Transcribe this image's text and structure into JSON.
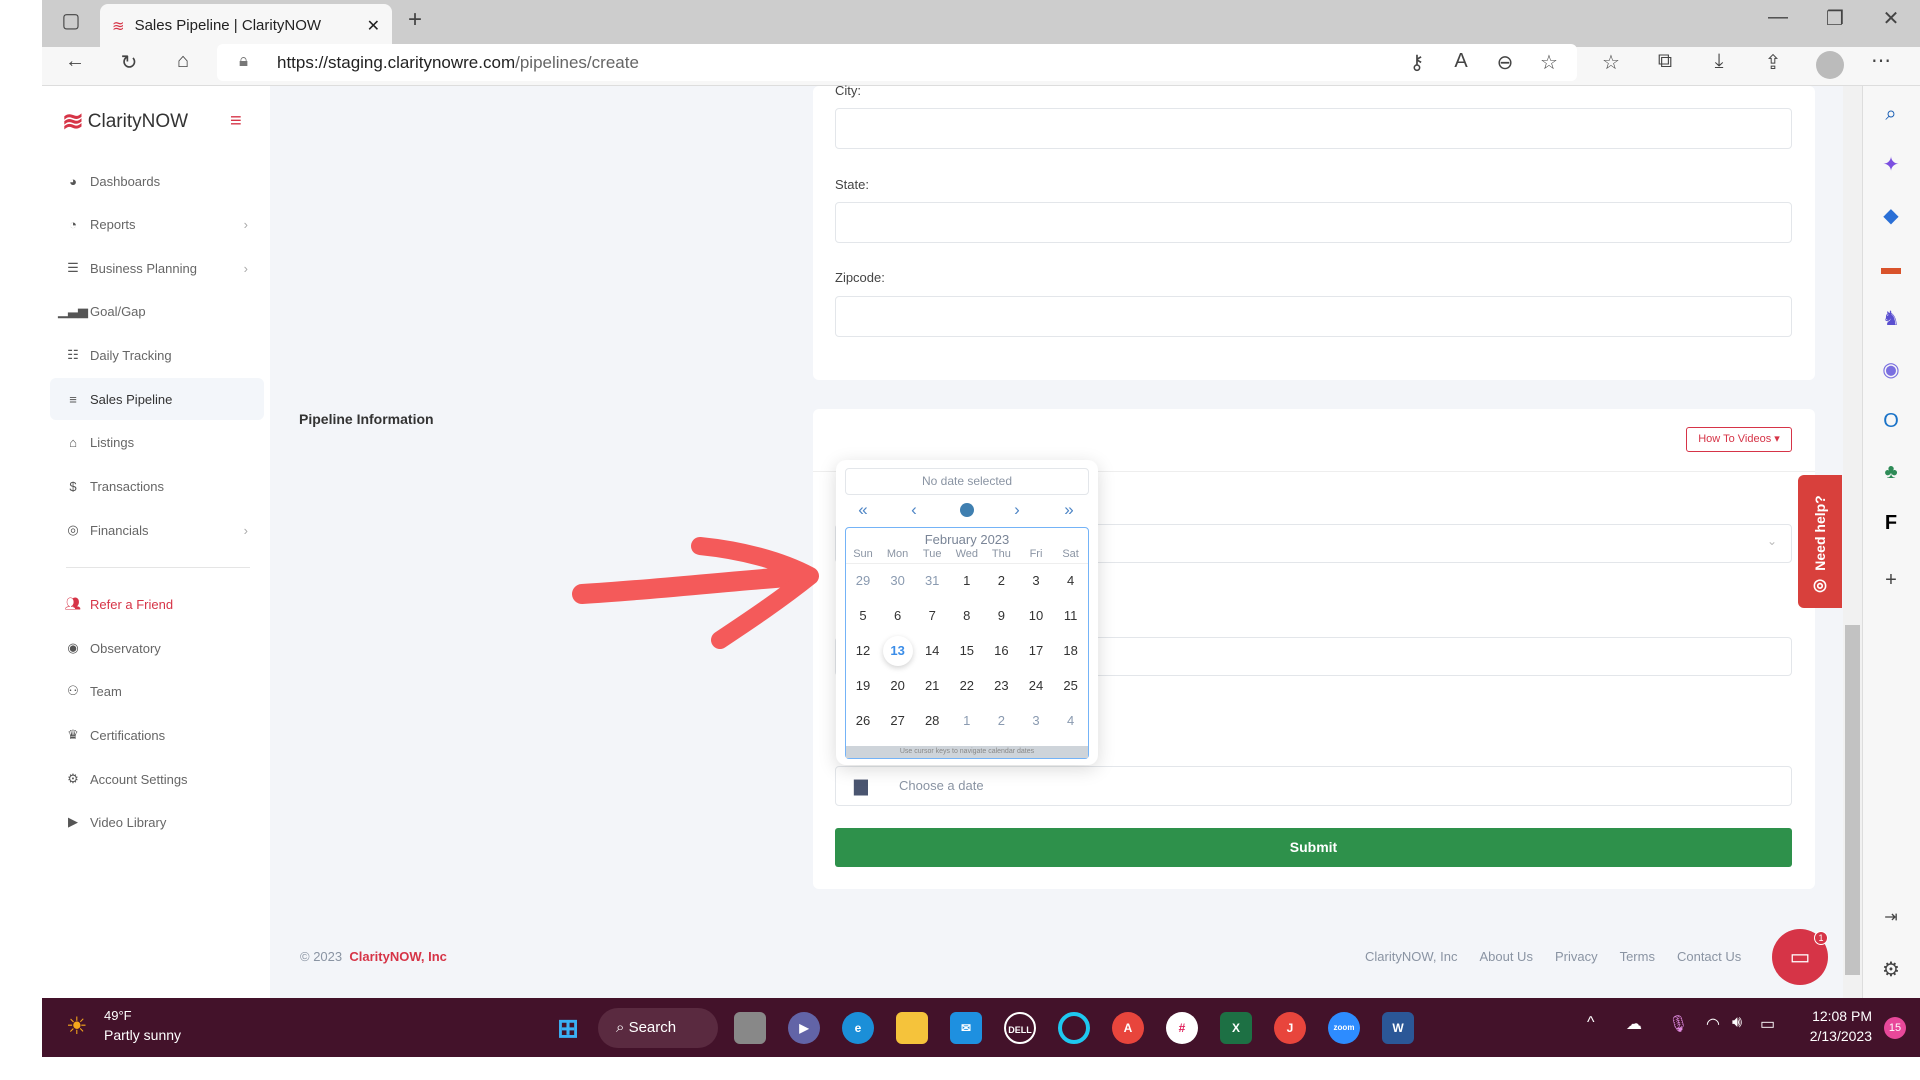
{
  "browser": {
    "tab_title": "Sales Pipeline | ClarityNOW",
    "url_host": "https://staging.claritynowre.com",
    "url_path": "/pipelines/create"
  },
  "sidebar": {
    "brand": "ClarityNOW",
    "items": [
      {
        "label": "Dashboards",
        "icon": "dashboard-icon"
      },
      {
        "label": "Reports",
        "icon": "pie-chart-icon",
        "has_submenu": true
      },
      {
        "label": "Business Planning",
        "icon": "checklist-icon",
        "has_submenu": true
      },
      {
        "label": "Goal/Gap",
        "icon": "signal-bars-icon"
      },
      {
        "label": "Daily Tracking",
        "icon": "list-icon"
      },
      {
        "label": "Sales Pipeline",
        "icon": "bars-icon",
        "active": true
      },
      {
        "label": "Listings",
        "icon": "home-icon"
      },
      {
        "label": "Transactions",
        "icon": "dollar-icon"
      },
      {
        "label": "Financials",
        "icon": "coins-icon",
        "has_submenu": true
      },
      {
        "label": "Refer a Friend",
        "icon": "users-icon",
        "highlight": true
      },
      {
        "label": "Observatory",
        "icon": "eye-icon"
      },
      {
        "label": "Team",
        "icon": "team-icon"
      },
      {
        "label": "Certifications",
        "icon": "crown-icon"
      },
      {
        "label": "Account Settings",
        "icon": "gear-icon"
      },
      {
        "label": "Video Library",
        "icon": "play-icon"
      }
    ]
  },
  "form": {
    "city_label": "City:",
    "state_label": "State:",
    "zipcode_label": "Zipcode:",
    "section_title": "Pipeline Information",
    "how_to_videos": "How To Videos",
    "date_placeholder": "Choose a date",
    "submit": "Submit"
  },
  "calendar": {
    "selected_text": "No date selected",
    "month": "February 2023",
    "weekdays": [
      "Sun",
      "Mon",
      "Tue",
      "Wed",
      "Thu",
      "Fri",
      "Sat"
    ],
    "weeks": [
      [
        "29",
        "30",
        "31",
        "1",
        "2",
        "3",
        "4"
      ],
      [
        "5",
        "6",
        "7",
        "8",
        "9",
        "10",
        "11"
      ],
      [
        "12",
        "13",
        "14",
        "15",
        "16",
        "17",
        "18"
      ],
      [
        "19",
        "20",
        "21",
        "22",
        "23",
        "24",
        "25"
      ],
      [
        "26",
        "27",
        "28",
        "1",
        "2",
        "3",
        "4"
      ]
    ],
    "today": "13",
    "help": "Use cursor keys to navigate calendar dates"
  },
  "need_help": "Need help?",
  "footer": {
    "copyright": "© 2023",
    "company": "ClarityNOW, Inc",
    "links": [
      "ClarityNOW, Inc",
      "About Us",
      "Privacy",
      "Terms",
      "Contact Us"
    ],
    "chat_badge": "1"
  },
  "taskbar": {
    "temp": "49°F",
    "weather": "Partly sunny",
    "search": "Search",
    "time": "12:08 PM",
    "date": "2/13/2023",
    "notifications": "15"
  },
  "colors": {
    "brand_red": "#d63447",
    "submit_green": "#2e914b",
    "calendar_blue": "#74b3f7",
    "arrow": "#f45a5a"
  }
}
